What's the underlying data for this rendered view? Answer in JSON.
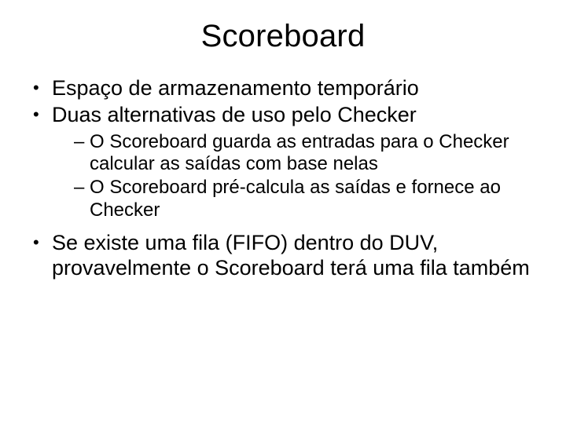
{
  "title": "Scoreboard",
  "bullets": {
    "b1": "Espaço de armazenamento temporário",
    "b2": "Duas alternativas de uso pelo Checker",
    "b2_sub1": "O Scoreboard guarda as entradas para o Checker calcular as saídas com base nelas",
    "b2_sub2": "O Scoreboard pré-calcula as saídas e fornece ao Checker",
    "b3": "Se existe uma fila (FIFO) dentro do DUV, provavelmente o Scoreboard terá uma fila também"
  }
}
